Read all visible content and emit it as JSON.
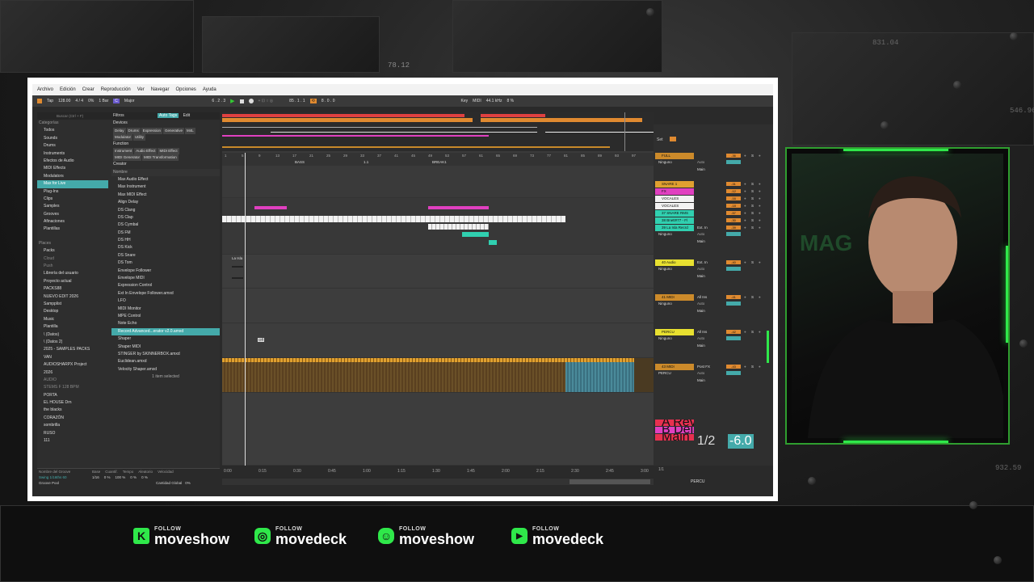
{
  "background": {
    "readouts": [
      "78.12",
      "831.04",
      "546.96",
      "932.59"
    ]
  },
  "menu": [
    "Archivo",
    "Edición",
    "Crear",
    "Reproducción",
    "Ver",
    "Navegar",
    "Opciones",
    "Ayuda"
  ],
  "control_bar": {
    "tap": "Tap",
    "tempo": "128.00",
    "time_sig": "4 / 4",
    "metro": "0%",
    "bar": "1 Bar",
    "key": "C",
    "scale": "Major",
    "position": "6 . 2 . 3",
    "loop_start": "85 . 1 . 1",
    "loop_len": "8 . 0 . 0",
    "key_btn": "Key",
    "midi_btn": "MIDI",
    "sample_rate": "44.1 kHz",
    "cpu": "8 %"
  },
  "browser": {
    "search_placeholder": "Buscar (Ctrl + F)",
    "categories_header": "Categorías",
    "categories": [
      "Todos",
      "Sounds",
      "Drums",
      "Instruments",
      "Efectos de Audio",
      "MIDI Effects",
      "Modulators",
      "Max for Live",
      "Plug-Ins",
      "Clips",
      "Samples",
      "Grooves",
      "Afinaciones",
      "Plantillas"
    ],
    "places_header": "Places",
    "places": [
      "Packs",
      "Cloud",
      "Push",
      "Librería del usuario",
      "Proyecto actual",
      "PACKS88",
      "NUEVO EDIT 2026",
      "Sampplist",
      "Desktop",
      "Music",
      "Plantilla",
      "\\ (Datos)",
      "\\ (Datos 2)",
      "2025 - SAMPLES PACKS",
      "VAN",
      "AUDIOSHARPX Project",
      "2026",
      "AUDIO",
      "STEMS F 128 BPM",
      "PORTA",
      "EL HOUSE Drn",
      "the blacks",
      "CORAZÓN",
      "sombrilla",
      "RUSO",
      "111"
    ],
    "filters_label": "Filtros",
    "auto_tags": "Auto Tags",
    "edit": "Edit",
    "devices_label": "Devices",
    "device_tags": [
      "Delay",
      "Drums",
      "Expression",
      "Generative",
      "M4L",
      "Modulator",
      "Utility"
    ],
    "function_label": "Function",
    "function_tags": [
      "Instrument",
      "Audio Effect",
      "MIDI Effect",
      "MIDI Generator",
      "MIDI Transformation"
    ],
    "creator_label": "Creator",
    "name_header": "Nombre",
    "items": [
      "Max Audio Effect",
      "Max Instrument",
      "Max MIDI Effect",
      "Align Delay",
      "DS Clang",
      "DS Clap",
      "DS Cymbal",
      "DS FM",
      "DS HH",
      "DS Kick",
      "DS Snare",
      "DS Tom",
      "Envelope Follower",
      "Envelope MIDI",
      "Expression Control",
      "Ext In Envelope Follower.amxd",
      "LFO",
      "MIDI Monitor",
      "MPE Control",
      "Note Echo",
      "Record Advanced...erator v2.0.amxd",
      "Shaper",
      "Shaper MIDI",
      "STINGER by SKINNERBOX.amxd",
      "Euclidean.amxd",
      "Velocity Shaper.amxd"
    ],
    "selected_count": "1 item selected",
    "groove_header": [
      "Nombre del Groove",
      "Base",
      "Cuantif.",
      "Tempo",
      "Aleatorio",
      "Velocidad"
    ],
    "groove_row": [
      "Swing 1/16ths 60",
      "1/16",
      "0 %",
      "100 %",
      "0 %",
      "0 %"
    ],
    "groove_pool": "Groove Pool",
    "global_amount_label": "Cantidad Global",
    "global_amount": "0%"
  },
  "arrangement": {
    "ruler_ticks": [
      "1",
      "5",
      "9",
      "13",
      "17",
      "21",
      "25",
      "29",
      "33",
      "37",
      "41",
      "45",
      "49",
      "53",
      "57",
      "61",
      "65",
      "69",
      "73",
      "77",
      "81",
      "85",
      "89",
      "93",
      "97"
    ],
    "locators": [
      "BASS",
      "1.1",
      "BREAK1"
    ],
    "clip_label": "La Isla",
    "off_label": "Off",
    "time_ticks": [
      "0:00",
      "0:15",
      "0:30",
      "0:45",
      "1:00",
      "1:15",
      "1:30",
      "1:45",
      "2:00",
      "2:15",
      "2:30",
      "2:45",
      "3:00"
    ],
    "page": "1/1"
  },
  "mixer": {
    "set_label": "Set",
    "tracks": [
      {
        "name": "FULL",
        "route": "Ninguno",
        "out": "Main",
        "vol": "-36",
        "color": "#cc8a2a"
      },
      {
        "name": "SNARE 1",
        "route": "",
        "out": "",
        "vol": "-31",
        "color": "#e0a030"
      },
      {
        "name": "FX",
        "route": "",
        "out": "",
        "vol": "-12",
        "color": "#e040c0"
      },
      {
        "name": "VOCALES",
        "route": "",
        "out": "",
        "vol": "-16",
        "color": "#f2f2f2"
      },
      {
        "name": "VOCALES",
        "route": "",
        "out": "",
        "vol": "-18",
        "color": "#f2f2f2"
      },
      {
        "name": "37 SNARE RMS",
        "route": "",
        "out": "",
        "vol": "-57",
        "color": "#30d0b0"
      },
      {
        "name": "38 Bnett#77 - Fl",
        "route": "",
        "out": "",
        "vol": "-30",
        "color": "#30d0b0"
      },
      {
        "name": "39 La Isla Recrd",
        "route": "Ninguno",
        "out": "Main",
        "vol": "-39",
        "color": "#30d0b0",
        "input": "Ext. In"
      },
      {
        "name": "40 Audio",
        "route": "Ninguno",
        "out": "Main",
        "vol": "-40",
        "color": "#e8e030",
        "input": "Ext. In"
      },
      {
        "name": "41 MIDI",
        "route": "Ninguno",
        "out": "Main",
        "vol": "-41",
        "color": "#cc8a2a",
        "input": "All Ins"
      },
      {
        "name": "PERCU",
        "route": "Ninguno",
        "out": "Main",
        "vol": "-42",
        "color": "#e8e030",
        "input": "All Ins"
      },
      {
        "name": "43 MIDI",
        "route": "PERCU",
        "out": "Main",
        "vol": "-43",
        "color": "#cc8a2a",
        "input": "Post FX"
      }
    ],
    "returns": [
      {
        "name": "A Reverb",
        "color": "#e83050"
      },
      {
        "name": "B Delay",
        "color": "#e040c0"
      },
      {
        "name": "Main",
        "color": "#e83050"
      }
    ],
    "auto_label": "Auto",
    "off_label": "Off",
    "in_label": "In",
    "master_vol": "1/2",
    "master_db": "-6.0",
    "status": "PERCU"
  },
  "socials": [
    {
      "icon": "kick-icon",
      "follow": "FOLLOW",
      "handle": "moveshow"
    },
    {
      "icon": "instagram-icon",
      "follow": "FOLLOW",
      "handle": "movedeck"
    },
    {
      "icon": "discord-icon",
      "follow": "FOLLOW",
      "handle": "moveshow"
    },
    {
      "icon": "youtube-icon",
      "follow": "FOLLOW",
      "handle": "movedeck"
    }
  ],
  "colors": {
    "accent": "#2fe84a",
    "ableton_orange": "#e08a30",
    "ableton_teal": "#4aa"
  }
}
